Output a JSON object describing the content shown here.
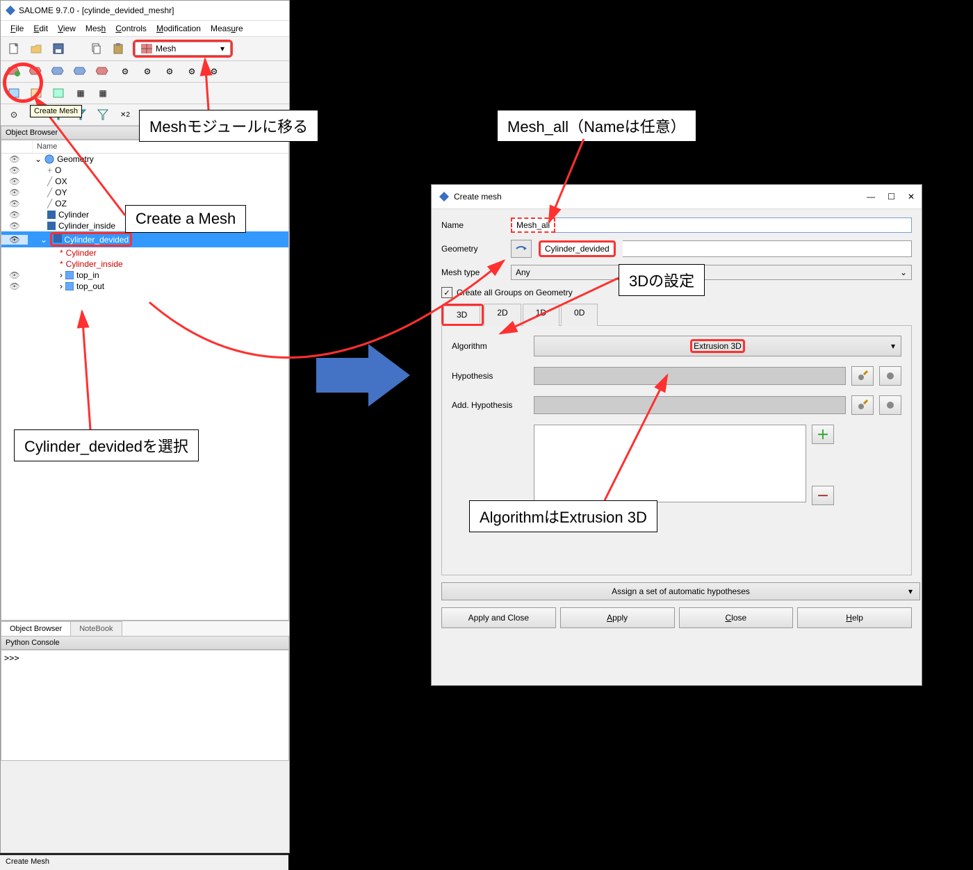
{
  "salome": {
    "title": "SALOME 9.7.0 - [cylinde_devided_meshr]",
    "menu": {
      "file": "File",
      "edit": "Edit",
      "view": "View",
      "mesh": "Mesh",
      "controls": "Controls",
      "modification": "Modification",
      "measure": "Measure"
    },
    "module_selector": "Mesh",
    "create_mesh_tooltip": "Create Mesh",
    "object_browser_title": "Object Browser",
    "tree_header_name": "Name",
    "tree": {
      "geometry": "Geometry",
      "o": "O",
      "ox": "OX",
      "oy": "OY",
      "oz": "OZ",
      "cyl": "Cylinder",
      "cyl_in": "Cylinder_inside",
      "cyl_dev": "Cylinder_devided",
      "child_cyl": "Cylinder",
      "child_cyl_in": "Cylinder_inside",
      "top_in": "top_in",
      "top_out": "top_out"
    },
    "tabs": {
      "ob": "Object Browser",
      "nb": "NoteBook"
    },
    "python_console_title": "Python Console",
    "prompt": ">>>",
    "statusbar": "Create Mesh"
  },
  "dialog": {
    "title": "Create mesh",
    "name_label": "Name",
    "name_value": "Mesh_all",
    "geom_label": "Geometry",
    "geom_value": "Cylinder_devided",
    "meshtype_label": "Mesh type",
    "meshtype_value": "Any",
    "checkbox": "Create all Groups on Geometry",
    "tabs": {
      "d3": "3D",
      "d2": "2D",
      "d1": "1D",
      "d0": "0D"
    },
    "algo_label": "Algorithm",
    "algo_value": "Extrusion 3D",
    "hyp_label": "Hypothesis",
    "addhyp_label": "Add. Hypothesis",
    "auto": "Assign a set of automatic hypotheses",
    "buttons": {
      "apply_close": "Apply and Close",
      "apply": "Apply",
      "close": "Close",
      "help": "Help"
    }
  },
  "annotations": {
    "mesh_module": "Meshモジュールに移る",
    "create_mesh": "Create a Mesh",
    "select_cyl": "Cylinder_devidedを選択",
    "mesh_all": "Mesh_all（Nameは任意）",
    "set_3d": "3Dの設定",
    "algo_ext": "AlgorithmはExtrusion 3D"
  }
}
